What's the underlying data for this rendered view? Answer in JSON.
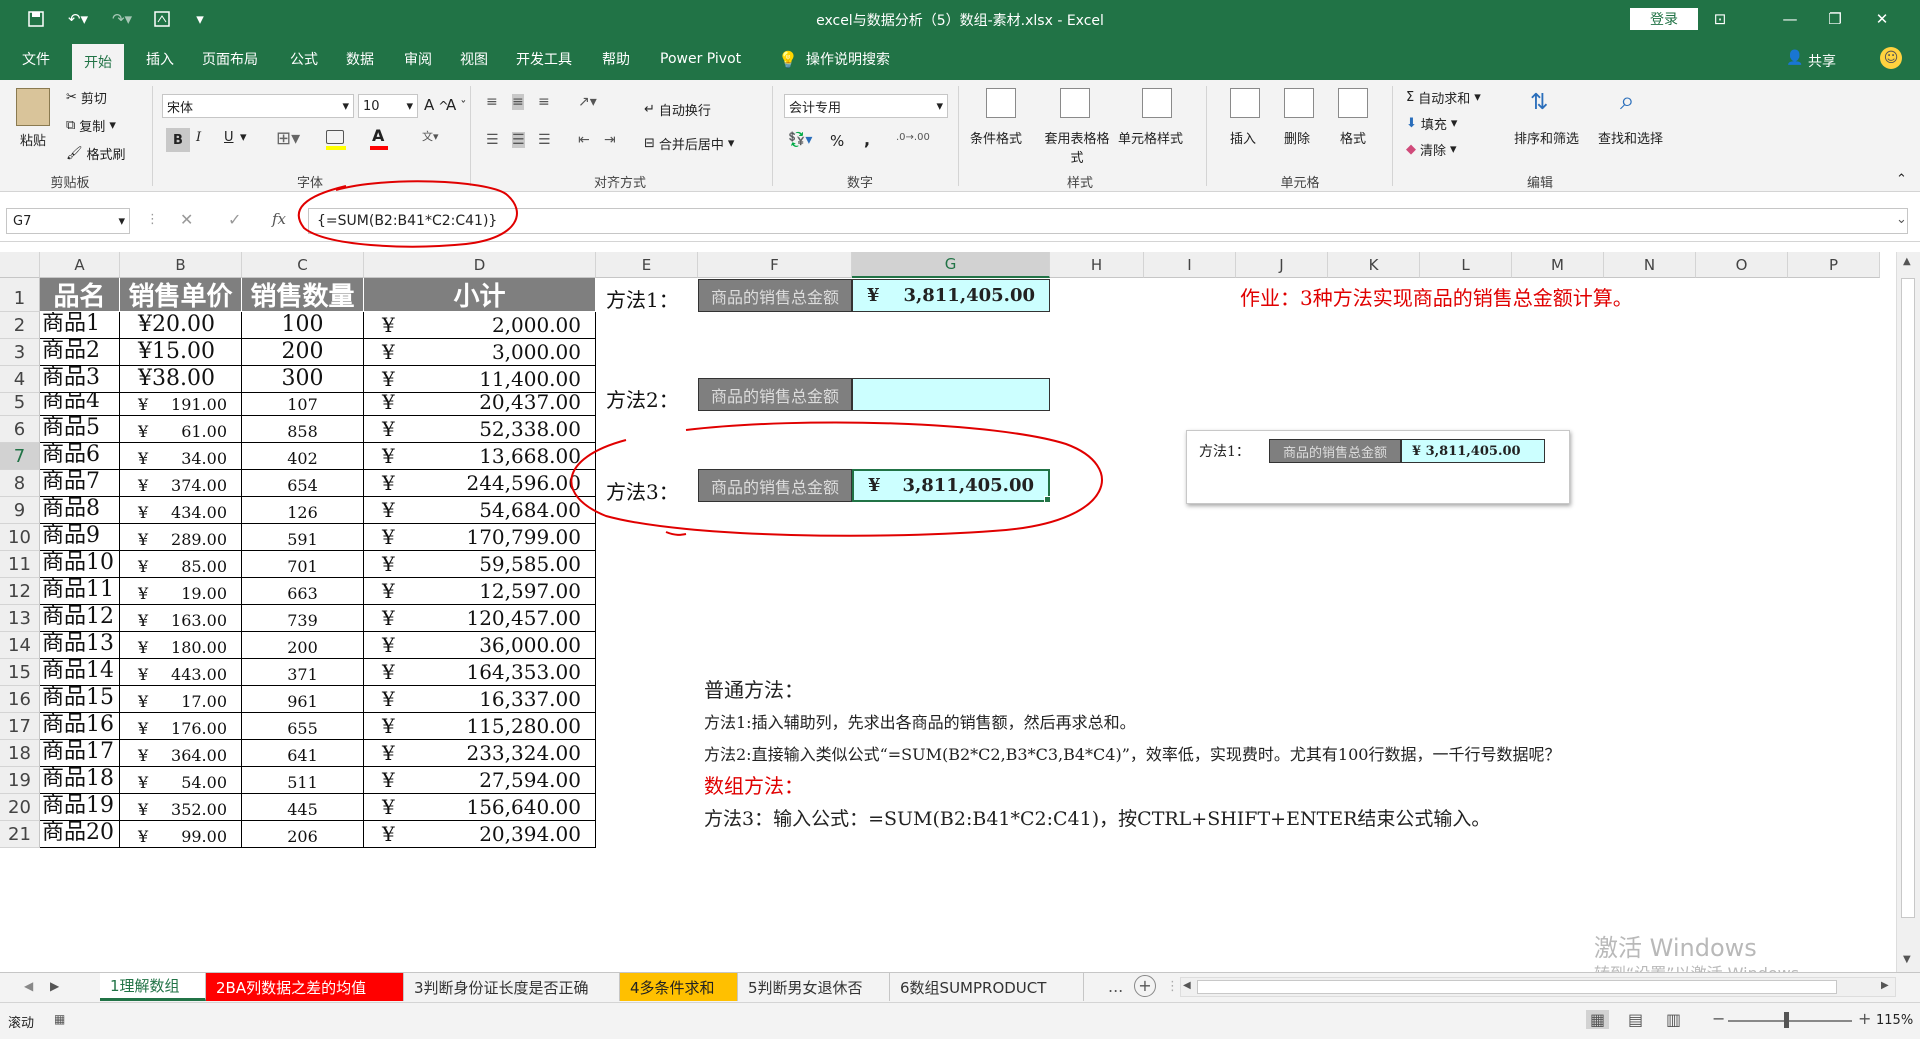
{
  "app": {
    "title": "excel与数据分析（5）数组-素材.xlsx  -  Excel",
    "login": "登录",
    "share": "共享"
  },
  "ribbon_tabs": [
    "文件",
    "开始",
    "插入",
    "页面布局",
    "公式",
    "数据",
    "审阅",
    "视图",
    "开发工具",
    "帮助",
    "Power Pivot",
    "操作说明搜索"
  ],
  "ribbon": {
    "clipboard": {
      "paste": "粘贴",
      "cut": "剪切",
      "copy": "复制",
      "format_painter": "格式刷",
      "label": "剪贴板"
    },
    "font": {
      "name": "宋体",
      "size": "10",
      "bold": "B",
      "italic": "I",
      "underline": "U",
      "label": "字体"
    },
    "align": {
      "wrap": "自动换行",
      "merge": "合并后居中",
      "label": "对齐方式"
    },
    "number": {
      "format": "会计专用",
      "percent": "%",
      "comma": ",",
      "label": "数字"
    },
    "styles": {
      "cond": "条件格式",
      "table": "套用表格格式",
      "cell": "单元格样式",
      "label": "样式"
    },
    "cells": {
      "insert": "插入",
      "delete": "删除",
      "format": "格式",
      "label": "单元格"
    },
    "editing": {
      "autosum": "自动求和",
      "fill": "填充",
      "clear": "清除",
      "sort": "排序和筛选",
      "find": "查找和选择",
      "label": "编辑"
    }
  },
  "formula_bar": {
    "name_box": "G7",
    "formula": "{=SUM(B2:B41*C2:C41)}",
    "fx": "fx"
  },
  "columns": [
    "A",
    "B",
    "C",
    "D",
    "E",
    "F",
    "G",
    "H",
    "I",
    "J",
    "K",
    "L",
    "M",
    "N",
    "O",
    "P"
  ],
  "selected_column": "G",
  "selected_row": 7,
  "rows": [
    "1",
    "2",
    "3",
    "4",
    "5",
    "6",
    "7",
    "8",
    "9",
    "10",
    "11",
    "12",
    "13",
    "14",
    "15",
    "16",
    "17",
    "18",
    "19",
    "20",
    "21"
  ],
  "table": {
    "headers": [
      "品名",
      "销售单价",
      "销售数量",
      "小计"
    ],
    "currency": "¥",
    "data": [
      [
        "商品1",
        "¥20.00",
        "100",
        "2,000.00"
      ],
      [
        "商品2",
        "¥15.00",
        "200",
        "3,000.00"
      ],
      [
        "商品3",
        "¥38.00",
        "300",
        "11,400.00"
      ],
      [
        "商品4",
        "191.00",
        "107",
        "20,437.00"
      ],
      [
        "商品5",
        "61.00",
        "858",
        "52,338.00"
      ],
      [
        "商品6",
        "34.00",
        "402",
        "13,668.00"
      ],
      [
        "商品7",
        "374.00",
        "654",
        "244,596.00"
      ],
      [
        "商品8",
        "434.00",
        "126",
        "54,684.00"
      ],
      [
        "商品9",
        "289.00",
        "591",
        "170,799.00"
      ],
      [
        "商品10",
        "85.00",
        "701",
        "59,585.00"
      ],
      [
        "商品11",
        "19.00",
        "663",
        "12,597.00"
      ],
      [
        "商品12",
        "163.00",
        "739",
        "120,457.00"
      ],
      [
        "商品13",
        "180.00",
        "200",
        "36,000.00"
      ],
      [
        "商品14",
        "443.00",
        "371",
        "164,353.00"
      ],
      [
        "商品15",
        "17.00",
        "961",
        "16,337.00"
      ],
      [
        "商品16",
        "176.00",
        "655",
        "115,280.00"
      ],
      [
        "商品17",
        "364.00",
        "641",
        "233,324.00"
      ],
      [
        "商品18",
        "54.00",
        "511",
        "27,594.00"
      ],
      [
        "商品19",
        "352.00",
        "445",
        "156,640.00"
      ],
      [
        "商品20",
        "99.00",
        "206",
        "20,394.00"
      ]
    ]
  },
  "methods": {
    "m1_label": "方法1：",
    "m2_label": "方法2：",
    "m3_label": "方法3：",
    "total_label": "商品的销售总金额",
    "m1_value": "3,811,405.00",
    "m3_value": "3,811,405.00",
    "currency": "¥"
  },
  "homework": "作业：3种方法实现商品的销售总金额计算。",
  "floating_image": {
    "label": "方法1：",
    "total_label": "商品的销售总金额",
    "value": "¥  3,811,405.00"
  },
  "notes": {
    "ordinary_title": "普通方法：",
    "note1": "方法1:插入辅助列，先求出各商品的销售额，然后再求总和。",
    "note2": "方法2:直接输入类似公式“=SUM(B2*C2,B3*C3,B4*C4)”，效率低，实现费时。尤其有100行数据，一千行号数据呢？",
    "array_title": "数组方法：",
    "note3": "方法3：输入公式：=SUM(B2:B41*C2:C41)，按CTRL+SHIFT+ENTER结束公式输入。"
  },
  "sheet_tabs": [
    {
      "label": "1理解数组",
      "active": true,
      "color": ""
    },
    {
      "label": "2BA列数据之差的均值",
      "active": false,
      "color": "#ff0000"
    },
    {
      "label": "3判断身份证长度是否正确",
      "active": false,
      "color": ""
    },
    {
      "label": "4多条件求和",
      "active": false,
      "color": "#ffc000"
    },
    {
      "label": "5判断男女退休否",
      "active": false,
      "color": ""
    },
    {
      "label": "6数组SUMPRODUCT",
      "active": false,
      "color": ""
    }
  ],
  "sheet_more": "...",
  "watermark": {
    "line1": "激活 Windows",
    "line2": "转到“设置”以激活 Windows。"
  },
  "status": {
    "mode": "滚动",
    "zoom": "115%"
  },
  "colors": {
    "excel_green": "#217346",
    "header_gray": "#7f7f7f",
    "cyan": "#ccffff",
    "annotation_red": "#e00000"
  }
}
